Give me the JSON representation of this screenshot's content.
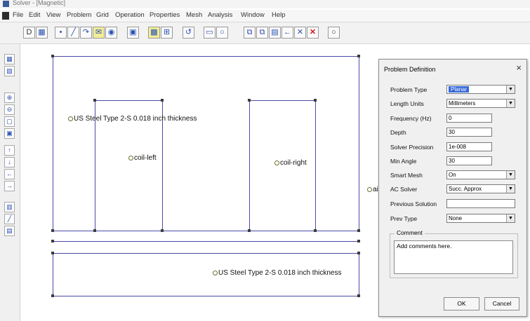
{
  "window": {
    "title": "Solver - [Magnetic]"
  },
  "menu": [
    "File",
    "Edit",
    "View",
    "Problem",
    "Grid",
    "Operation",
    "Properties",
    "Mesh",
    "Analysis",
    "Window",
    "Help"
  ],
  "toolbar": {
    "icons": [
      "new-file-icon",
      "open-file-icon",
      "select-point-icon",
      "draw-line-icon",
      "draw-arc-icon",
      "group-icon",
      "zoom-window-icon",
      "snap-grid-icon",
      "mesh-icon",
      "undo-icon",
      "rectangle-icon",
      "circle-icon",
      "copy-icon",
      "paste-icon",
      "move-icon",
      "mirror-icon",
      "select-icon",
      "delete-icon",
      "settings-icon"
    ],
    "glyphs": [
      "D",
      "▦",
      "•",
      "╱",
      "↷",
      "✉",
      "◉",
      "▣",
      "▩",
      "⊞",
      "↺",
      "▭",
      "○",
      "⧉",
      "⧉",
      "▤",
      "←",
      "✕",
      "○"
    ]
  },
  "leftstrip": {
    "icons": [
      "node-mode-icon",
      "segment-mode-icon",
      "zoom-in-icon",
      "zoom-out-icon",
      "zoom-extents-icon",
      "zoom-window-icon",
      "pan-up-icon",
      "pan-down-icon",
      "pan-left-icon",
      "pan-right-icon",
      "grid-toggle-icon",
      "arc-mode-icon",
      "block-label-icon"
    ],
    "glyphs": [
      "▦",
      "▧",
      "⊕",
      "⊖",
      "▢",
      "▣",
      "↑",
      "↓",
      "←",
      "→",
      "▥",
      "╱",
      "▤"
    ]
  },
  "canvas": {
    "labels": [
      {
        "name": "label-steel-top",
        "text": "US Steel Type 2-S 0.018 inch thickness"
      },
      {
        "name": "label-coil-left",
        "text": "coil-left"
      },
      {
        "name": "label-coil-right",
        "text": "coil-right"
      },
      {
        "name": "label-air",
        "text": "air"
      },
      {
        "name": "label-steel-bottom",
        "text": "US Steel Type 2-S 0.018 inch thickness"
      }
    ]
  },
  "dialog": {
    "title": "Problem Definition",
    "close": "×",
    "fields": [
      {
        "name": "problem-type",
        "label": "Problem Type",
        "value": "Planar",
        "kind": "select",
        "highlight": true
      },
      {
        "name": "length-units",
        "label": "Length Units",
        "value": "Millimeters",
        "kind": "select"
      },
      {
        "name": "frequency",
        "label": "Frequency (Hz)",
        "value": "0",
        "kind": "input"
      },
      {
        "name": "depth",
        "label": "Depth",
        "value": "30",
        "kind": "input"
      },
      {
        "name": "solver-precision",
        "label": "Solver Precision",
        "value": "1e-008",
        "kind": "input"
      },
      {
        "name": "min-angle",
        "label": "Min Angle",
        "value": "30",
        "kind": "input"
      },
      {
        "name": "smart-mesh",
        "label": "Smart Mesh",
        "value": "On",
        "kind": "select"
      },
      {
        "name": "ac-solver",
        "label": "AC Solver",
        "value": "Succ. Approx",
        "kind": "select"
      },
      {
        "name": "previous-solution",
        "label": "Previous Solution",
        "value": "",
        "kind": "input"
      },
      {
        "name": "prev-type",
        "label": "Prev Type",
        "value": "None",
        "kind": "select"
      }
    ],
    "comment_legend": "Comment",
    "comment_text": "Add comments here.",
    "ok_label": "OK",
    "cancel_label": "Cancel",
    "accent_color": "#3468d8"
  }
}
